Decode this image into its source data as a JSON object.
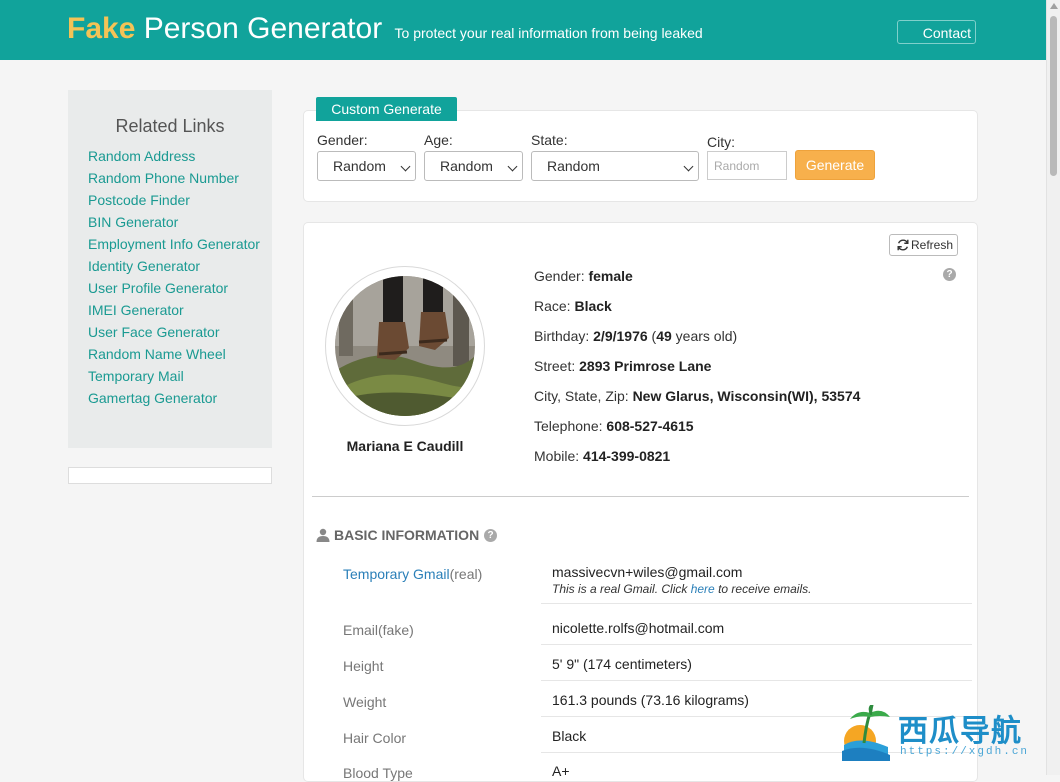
{
  "header": {
    "brand_fake": "Fake",
    "brand_rest": "Person Generator",
    "tagline": "To protect your real information from being leaked",
    "contact_label": "Contact"
  },
  "sidebar": {
    "title": "Related Links",
    "links": [
      "Random Address",
      "Random Phone Number",
      "Postcode Finder",
      "BIN Generator",
      "Employment Info Generator",
      "Identity Generator",
      "User Profile Generator",
      "IMEI Generator",
      "User Face Generator",
      "Random Name Wheel",
      "Temporary Mail",
      "Gamertag Generator"
    ]
  },
  "custom": {
    "tab_label": "Custom Generate",
    "gender_label": "Gender:",
    "gender_value": "Random",
    "age_label": "Age:",
    "age_value": "Random",
    "state_label": "State:",
    "state_value": "Random",
    "city_label": "City:",
    "city_placeholder": "Random",
    "generate_label": "Generate"
  },
  "person": {
    "refresh_label": "Refresh",
    "name": "Mariana E Caudill",
    "gender_label": "Gender:",
    "gender": "female",
    "race_label": "Race:",
    "race": "Black",
    "birthday_label": "Birthday:",
    "birthday": "2/9/1976",
    "age_open": "(",
    "age": "49",
    "age_suffix": "years old)",
    "street_label": "Street:",
    "street": "2893 Primrose Lane",
    "city_label": "City, State, Zip:",
    "city_state_zip": "New Glarus, Wisconsin(WI), 53574",
    "telephone_label": "Telephone:",
    "telephone": "608-527-4615",
    "mobile_label": "Mobile:",
    "mobile": "414-399-0821"
  },
  "basic": {
    "title": "BASIC INFORMATION",
    "gmail_label_link": "Temporary Gmail",
    "gmail_label_suffix": "(real)",
    "gmail_value": "massivecvn+wiles@gmail.com",
    "gmail_note_prefix": "This is a real Gmail. Click",
    "gmail_note_link": "here",
    "gmail_note_suffix": "to receive emails.",
    "email_label": "Email(fake)",
    "email_value": "nicolette.rolfs@hotmail.com",
    "height_label": "Height",
    "height_value": "5' 9\" (174 centimeters)",
    "weight_label": "Weight",
    "weight_value": "161.3 pounds (73.16 kilograms)",
    "hair_label": "Hair Color",
    "hair_value": "Black",
    "blood_label": "Blood Type",
    "blood_value": "A+"
  },
  "watermark": {
    "text": "西瓜导航",
    "url": "https://xgdh.cn"
  },
  "colors": {
    "brand_teal": "#11a39b",
    "brand_yellow": "#f4c356",
    "generate_orange": "#f7b04c",
    "link_teal": "#1a9a92",
    "link_blue": "#2a7fb8"
  }
}
